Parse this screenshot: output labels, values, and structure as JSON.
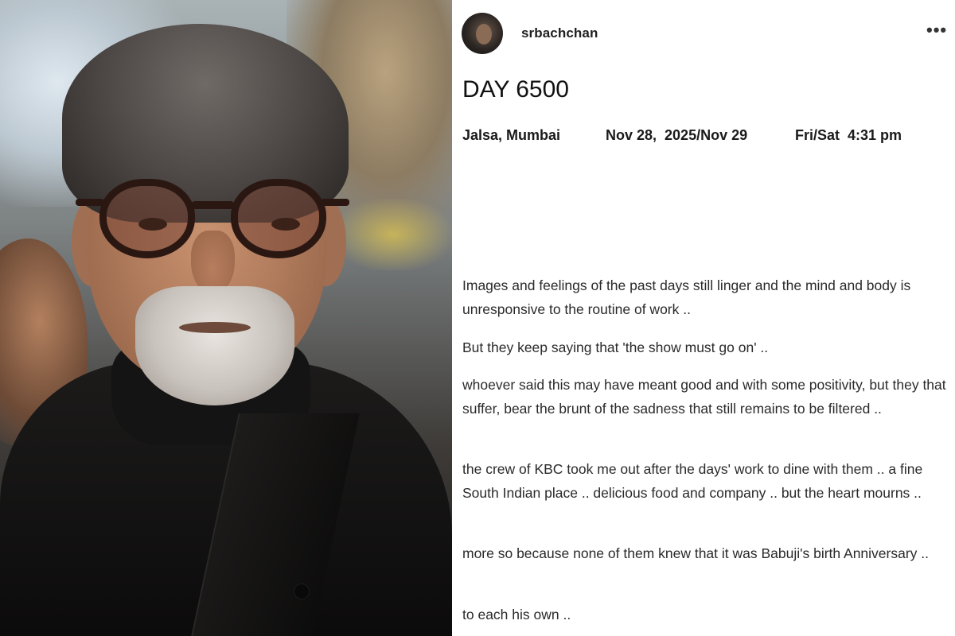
{
  "post": {
    "username": "srbachchan",
    "more_icon": "•••",
    "title": "DAY 6500",
    "location": "Jalsa, Mumbai",
    "date": "Nov 28,  2025/Nov 29",
    "time": "Fri/Sat  4:31 pm",
    "paragraphs": [
      "Images and feelings of the past days still linger and the mind and body is unresponsive to the routine of work ..",
      "But they keep saying that 'the show must go on' ..",
      "whoever said this may have meant good and with some positivity, but they that suffer, bear the brunt of the sadness that still remains to be filtered  ..",
      "the crew of KBC took me out after the days' work to dine with them .. a fine South Indian place .. delicious food and company .. but the heart mourns ..",
      "more so because none of them knew that it was Babuji's birth Anniversary ..",
      "to each his own .."
    ]
  }
}
